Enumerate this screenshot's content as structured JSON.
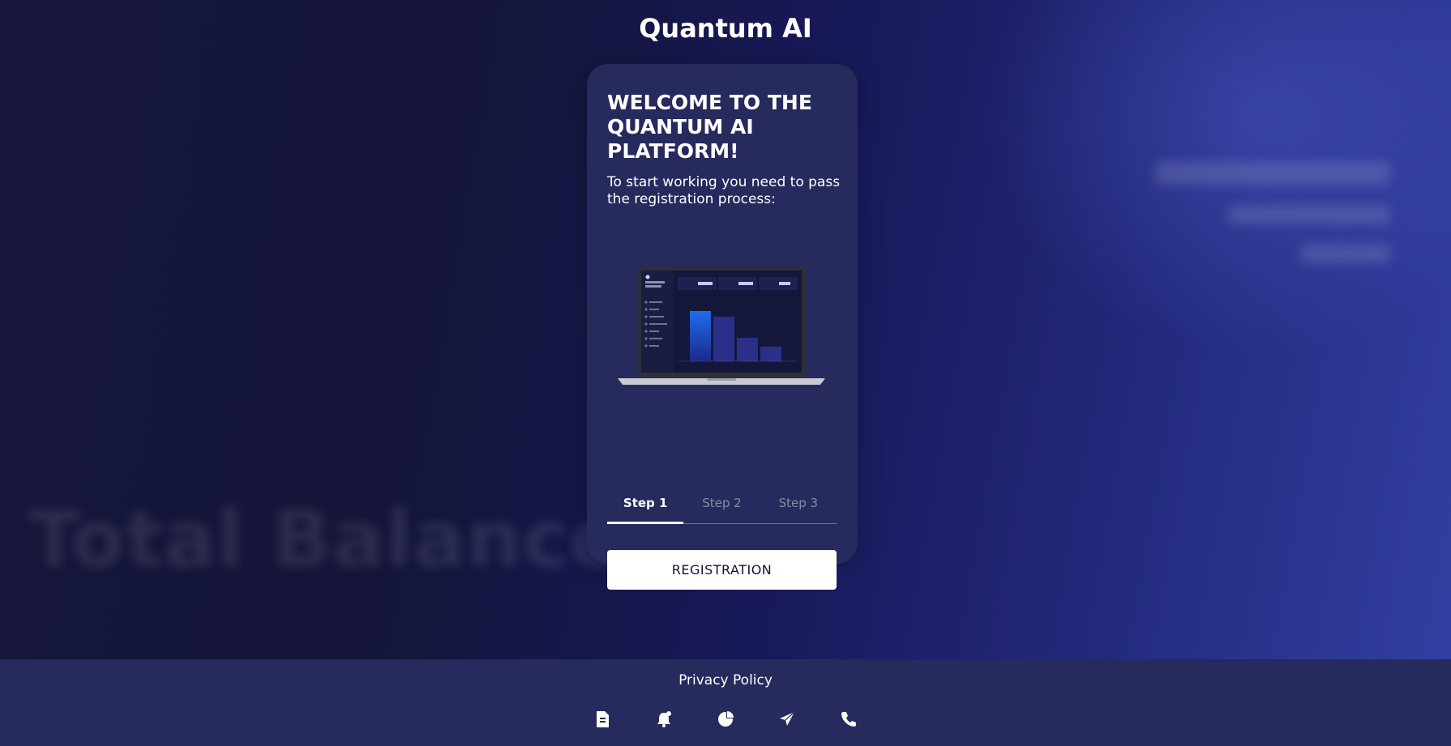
{
  "header": {
    "brand": "Quantum AI"
  },
  "card": {
    "title": "WELCOME TO THE QUANTUM AI PLATFORM!",
    "subtitle": "To start working you need to pass the registration process:",
    "steps": [
      "Step 1",
      "Step 2",
      "Step 3"
    ],
    "active_step": 0,
    "registration_label": "REGISTRATION"
  },
  "background": {
    "blurred_text": "Total Balance"
  },
  "footer": {
    "privacy_label": "Privacy Policy",
    "icons": [
      "document-icon",
      "bell-icon",
      "pie-chart-icon",
      "send-icon",
      "phone-icon"
    ]
  },
  "colors": {
    "card_bg": "#262a5c",
    "footer_bg": "#262a5c",
    "button_bg": "#ffffff",
    "accent_blue": "#1f6cf0"
  }
}
